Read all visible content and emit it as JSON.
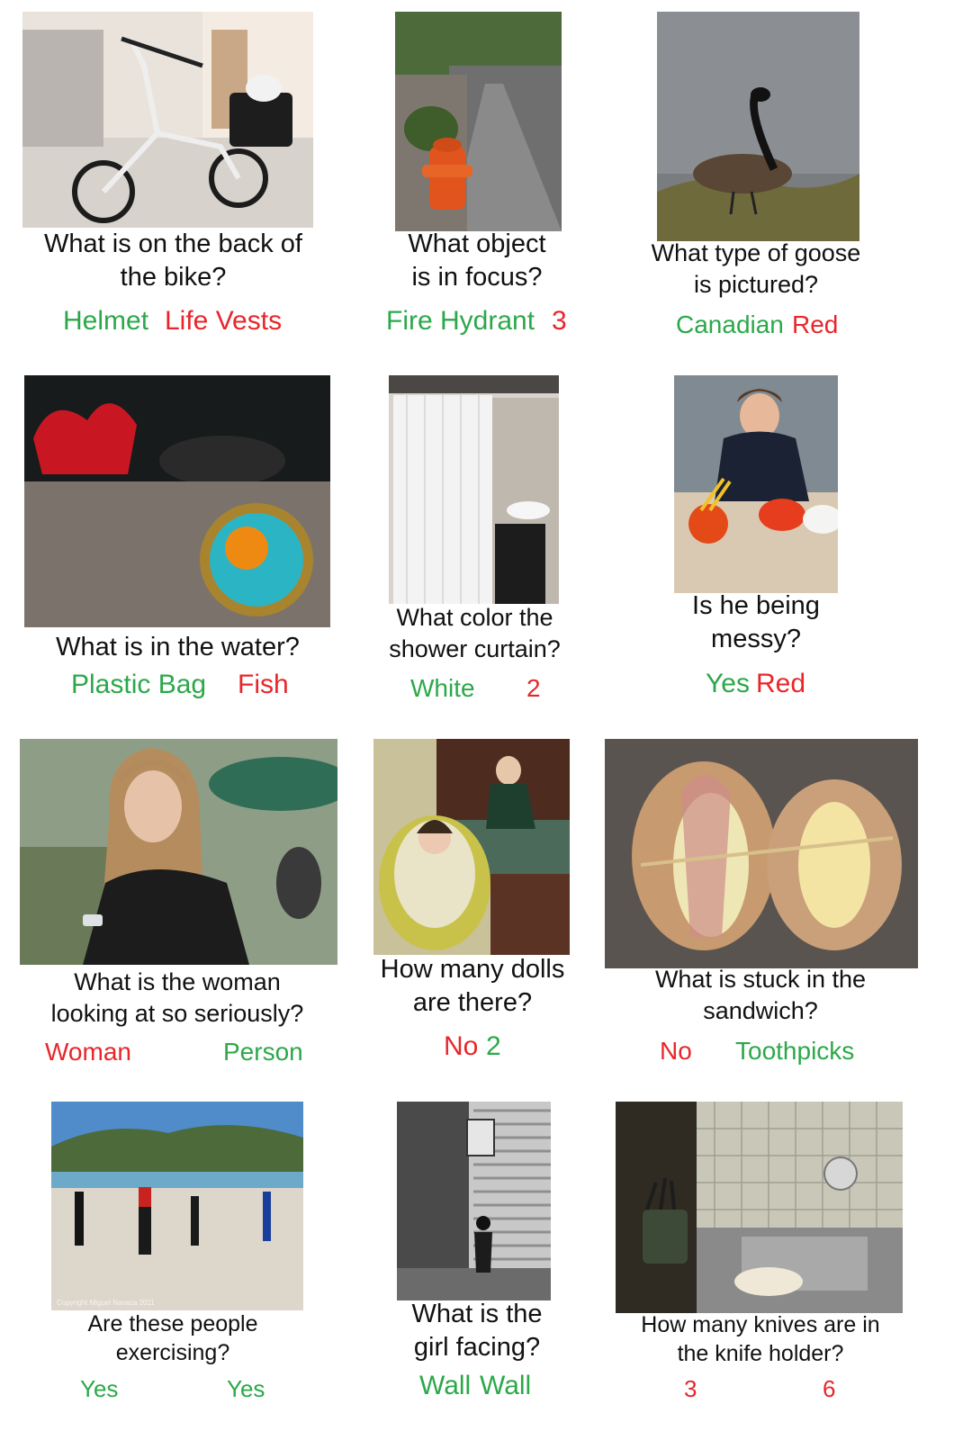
{
  "colors": {
    "correct": "#2ca84a",
    "incorrect": "#e8262a"
  },
  "panels": [
    {
      "question": [
        "What is on the back of",
        "the bike?"
      ],
      "answers": [
        {
          "text": "Helmet",
          "color": "green"
        },
        {
          "text": "Life Vests",
          "color": "red"
        }
      ]
    },
    {
      "question": [
        "What object",
        "is in focus?"
      ],
      "answers": [
        {
          "text": "Fire Hydrant",
          "color": "green"
        },
        {
          "text": "3",
          "color": "red"
        }
      ]
    },
    {
      "question": [
        "What type of goose",
        "is pictured?"
      ],
      "answers": [
        {
          "text": "Canadian",
          "color": "green"
        },
        {
          "text": "Red",
          "color": "red"
        }
      ]
    },
    {
      "question": [
        "What is in the water?"
      ],
      "answers": [
        {
          "text": "Plastic Bag",
          "color": "green"
        },
        {
          "text": "Fish",
          "color": "red"
        }
      ]
    },
    {
      "question": [
        "What color the",
        "shower curtain?"
      ],
      "answers": [
        {
          "text": "White",
          "color": "green"
        },
        {
          "text": "2",
          "color": "red"
        }
      ]
    },
    {
      "question": [
        "Is he being",
        "messy?"
      ],
      "answers": [
        {
          "text": "Yes",
          "color": "green"
        },
        {
          "text": "Red",
          "color": "red"
        }
      ]
    },
    {
      "question": [
        "What is the woman",
        "looking at so seriously?"
      ],
      "answers": [
        {
          "text": "Woman",
          "color": "red"
        },
        {
          "text": "Person",
          "color": "green"
        }
      ]
    },
    {
      "question": [
        "How many dolls",
        "are there?"
      ],
      "answers": [
        {
          "text": "No",
          "color": "red"
        },
        {
          "text": "2",
          "color": "green"
        }
      ]
    },
    {
      "question": [
        "What is stuck in the",
        "sandwich?"
      ],
      "answers": [
        {
          "text": "No",
          "color": "red"
        },
        {
          "text": "Toothpicks",
          "color": "green"
        }
      ]
    },
    {
      "question": [
        "Are these people",
        "exercising?"
      ],
      "answers": [
        {
          "text": "Yes",
          "color": "green"
        },
        {
          "text": "Yes",
          "color": "green"
        }
      ]
    },
    {
      "question": [
        "What is the",
        "girl facing?"
      ],
      "answers": [
        {
          "text": "Wall",
          "color": "green"
        },
        {
          "text": "Wall",
          "color": "green"
        }
      ]
    },
    {
      "question": [
        "How many knives are in",
        "the knife holder?"
      ],
      "answers": [
        {
          "text": "3",
          "color": "red"
        },
        {
          "text": "6",
          "color": "red"
        }
      ]
    }
  ],
  "watermark": "Copyright Miguel Navaza 2011"
}
